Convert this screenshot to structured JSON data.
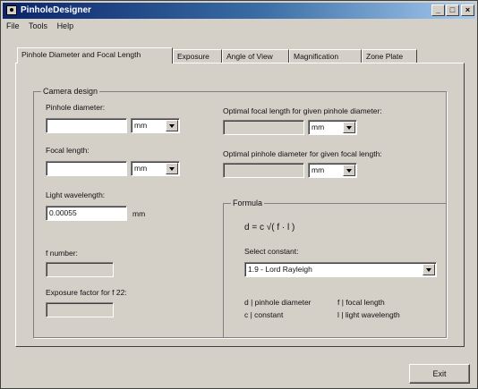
{
  "window": {
    "title": "PinholeDesigner"
  },
  "menu": [
    "File",
    "Tools",
    "Help"
  ],
  "tabs": [
    "Pinhole Diameter and Focal Length",
    "Exposure",
    "Angle of View",
    "Magnification",
    "Zone Plate"
  ],
  "camera": {
    "group_label": "Camera design",
    "pinhole_label": "Pinhole diameter:",
    "pinhole_value": "",
    "pinhole_unit": "mm",
    "focal_label": "Focal length:",
    "focal_value": "",
    "focal_unit": "mm",
    "wavelength_label": "Light wavelength:",
    "wavelength_value": "0.00055",
    "wavelength_unit": "mm",
    "fnumber_label": "f number:",
    "fnumber_value": "",
    "exposure_label": "Exposure factor for f 22:",
    "exposure_value": ""
  },
  "optimal": {
    "focal_label": "Optimal focal length for given pinhole diameter:",
    "focal_value": "",
    "focal_unit": "mm",
    "pinhole_label": "Optimal pinhole diameter for given focal length:",
    "pinhole_value": "",
    "pinhole_unit": "mm"
  },
  "formula": {
    "group_label": "Formula",
    "expression": "d = c √( f · l )",
    "constant_label": "Select constant:",
    "constant_value": "1.9 - Lord Rayleigh",
    "legend": {
      "d": "d | pinhole diameter",
      "f": "f | focal length",
      "c": "c | constant",
      "l": "l | light wavelength"
    }
  },
  "exit_label": "Exit",
  "colors": {
    "titlebar_start": "#0a246a",
    "titlebar_end": "#a6caf0",
    "face": "#d4d0c8"
  }
}
